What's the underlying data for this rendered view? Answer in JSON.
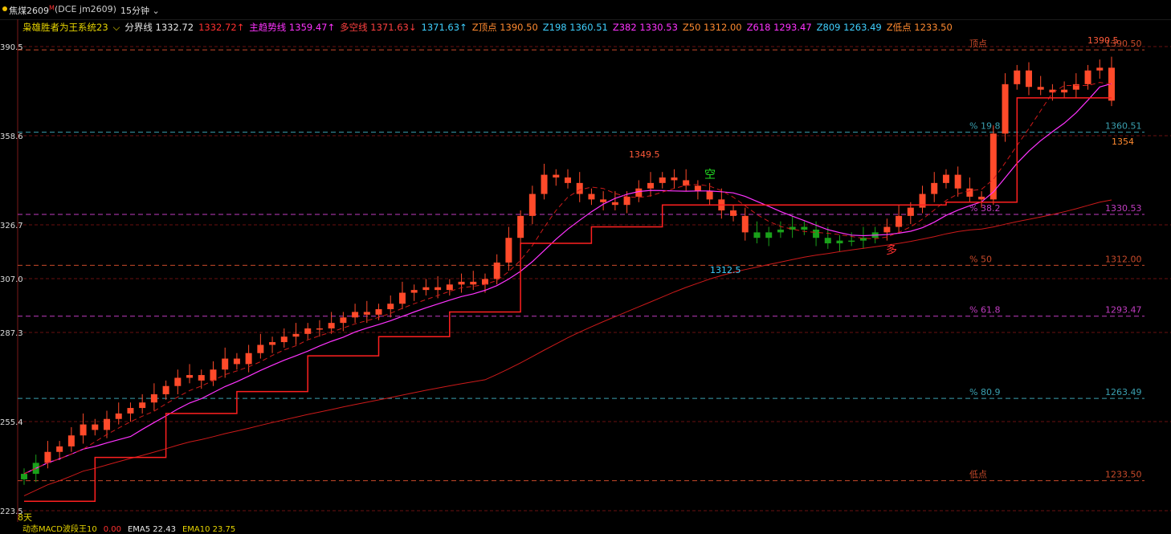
{
  "header": {
    "symbol": "焦煤2609",
    "symbol_mark": "M",
    "code": "(DCE  jm2609)",
    "period": "15分钟",
    "chevron_icon": "chevron-down-icon"
  },
  "indicator_row": [
    {
      "id": "system",
      "text": "枭雄胜者为王系统23",
      "color": "#e6d400"
    },
    {
      "id": "sys-chevron",
      "text": "⌵",
      "color": "#e6d400"
    },
    {
      "id": "fenjie",
      "text": "分界线 1332.72",
      "color": "#e8e8e8"
    },
    {
      "id": "fenjie-mark",
      "text": "1332.72↑",
      "color": "#ff3030"
    },
    {
      "id": "trend",
      "text": "主趋势线 1359.47↑",
      "color": "#ff33ff"
    },
    {
      "id": "longshort",
      "text": "多空线 1371.63↓",
      "color": "#ff4040"
    },
    {
      "id": "longshort-mark",
      "text": "1371.63↑",
      "color": "#3fd0ff"
    },
    {
      "id": "top",
      "text": "Z顶点 1390.50",
      "color": "#ff8a30"
    },
    {
      "id": "z198",
      "text": "Z198 1360.51",
      "color": "#3fd0ff"
    },
    {
      "id": "z382",
      "text": "Z382 1330.53",
      "color": "#ff33ff"
    },
    {
      "id": "z50",
      "text": "Z50 1312.00",
      "color": "#ff8a30"
    },
    {
      "id": "z618",
      "text": "Z618 1293.47",
      "color": "#ff33ff"
    },
    {
      "id": "z809",
      "text": "Z809 1263.49",
      "color": "#3fd0ff"
    },
    {
      "id": "zlow",
      "text": "Z低点 1233.50",
      "color": "#ff8a30"
    }
  ],
  "y_axis_labels": [
    "390.5",
    "358.6",
    "326.7",
    "307.0",
    "287.3",
    "255.4",
    "223.5"
  ],
  "fib_levels": [
    {
      "name": "顶点",
      "pct_label": "顶点",
      "value": "1390.50",
      "price": 1390.5,
      "color": "#c84a2a"
    },
    {
      "name": "19.8",
      "pct_label": "% 19.8",
      "value": "1360.51",
      "price": 1360.51,
      "color": "#3aa0b0"
    },
    {
      "name": "38.2",
      "pct_label": "% 38.2",
      "value": "1330.53",
      "price": 1330.53,
      "color": "#c03cc0"
    },
    {
      "name": "50",
      "pct_label": "% 50",
      "value": "1312.00",
      "price": 1312.0,
      "color": "#c84a2a"
    },
    {
      "name": "61.8",
      "pct_label": "% 61.8",
      "value": "1293.47",
      "price": 1293.47,
      "color": "#c03cc0"
    },
    {
      "name": "80.9",
      "pct_label": "% 80.9",
      "value": "1263.49",
      "price": 1263.49,
      "color": "#3aa0b0"
    },
    {
      "name": "低点",
      "pct_label": "低点",
      "value": "1233.50",
      "price": 1233.5,
      "color": "#c84a2a"
    }
  ],
  "annotations": [
    {
      "id": "peak-mid",
      "text": "1349.5",
      "color": "#ff5a3a"
    },
    {
      "id": "trough",
      "text": "1312.5",
      "color": "#3fd0ff"
    },
    {
      "id": "peak-top",
      "text": "1390.5",
      "color": "#ff5a3a"
    },
    {
      "id": "level-1354",
      "text": "1354",
      "color": "#ff8a30"
    },
    {
      "id": "short-signal",
      "text": "空",
      "color": "#22dd22"
    },
    {
      "id": "long-signal",
      "text": "多",
      "color": "#ff3030"
    },
    {
      "id": "days",
      "text": "8天",
      "color": "#e6d400"
    }
  ],
  "footer": [
    {
      "id": "macd",
      "text": "动态MACD波段王10",
      "color": "#e6d400"
    },
    {
      "id": "macd-val",
      "text": "0.00",
      "color": "#ff3030"
    },
    {
      "id": "ema5",
      "text": "EMA5 22.43",
      "color": "#e8e8e8"
    },
    {
      "id": "ema10",
      "text": "EMA10 23.75",
      "color": "#e6d400"
    }
  ],
  "chart_data": {
    "type": "candlestick",
    "ylim": [
      1225,
      1395
    ],
    "candle_close_up_color": "#ff4a2a",
    "candle_down_color": "#1aa01a",
    "series_colors": {
      "ma_fast": "#ff33ff",
      "ma_slow": "#cc1a1a",
      "ma_dash": "#cc1a1a",
      "stepline": "#ff2020"
    },
    "closes": [
      1236,
      1240,
      1244,
      1246,
      1250,
      1254,
      1252,
      1256,
      1258,
      1260,
      1262,
      1265,
      1268,
      1271,
      1272,
      1270,
      1274,
      1278,
      1276,
      1280,
      1283,
      1284,
      1286,
      1287,
      1289,
      1289,
      1291,
      1293,
      1295,
      1294,
      1296,
      1298,
      1302,
      1303,
      1304,
      1303,
      1305,
      1306,
      1305,
      1307,
      1313,
      1322,
      1330,
      1338,
      1345,
      1344,
      1342,
      1338,
      1336,
      1335,
      1334,
      1337,
      1340,
      1342,
      1344,
      1343,
      1341,
      1339,
      1336,
      1332,
      1330,
      1324,
      1322,
      1324,
      1325,
      1326,
      1325,
      1322,
      1320,
      1321,
      1321,
      1322,
      1324,
      1326,
      1330,
      1333,
      1338,
      1342,
      1345,
      1340,
      1337,
      1336,
      1360,
      1378,
      1383,
      1377,
      1376,
      1375,
      1376,
      1378,
      1383,
      1384,
      1372
    ]
  }
}
